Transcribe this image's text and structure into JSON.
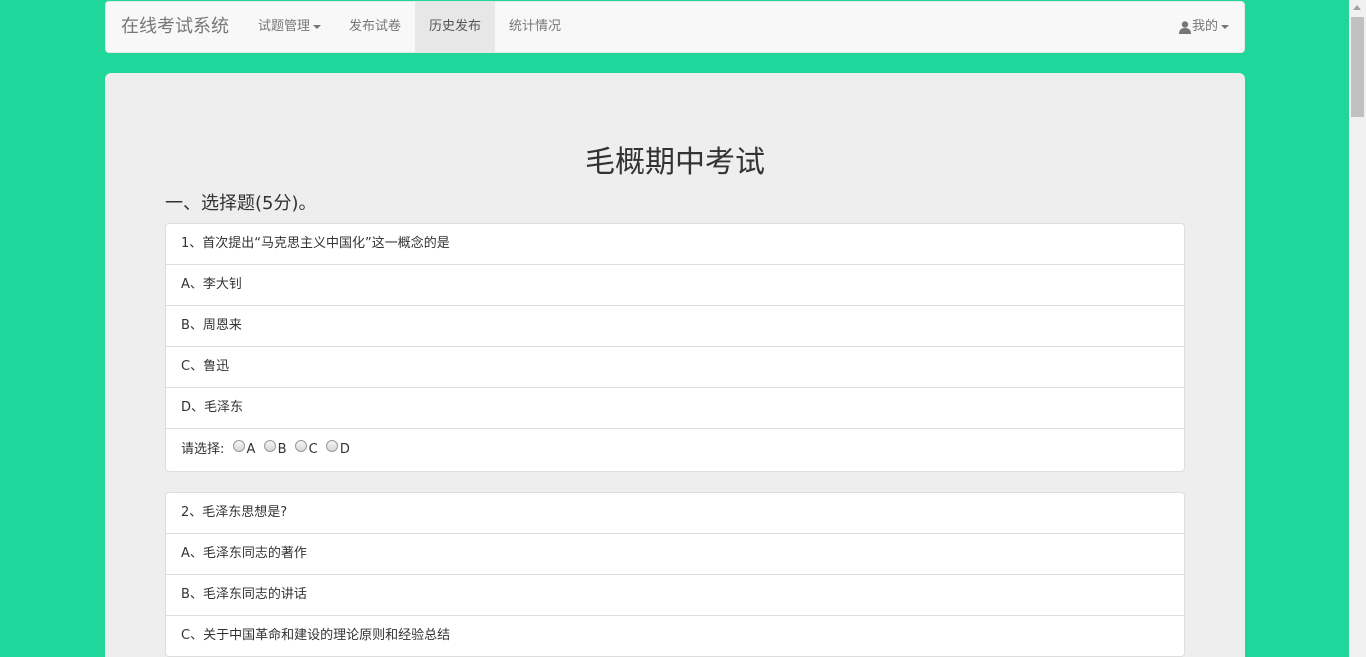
{
  "nav": {
    "brand": "在线考试系统",
    "items": [
      {
        "label": "试题管理",
        "dropdown": true
      },
      {
        "label": "发布试卷"
      },
      {
        "label": "历史发布",
        "active": true
      },
      {
        "label": "统计情况"
      }
    ],
    "user_menu": "我的"
  },
  "exam": {
    "title": "毛概期中考试",
    "section_title": "一、选择题(5分)。",
    "answer_prompt": "请选择:",
    "questions": [
      {
        "stem": "1、首次提出“马克思主义中国化”这一概念的是",
        "options": [
          "A、李大钊",
          "B、周恩来",
          "C、鲁迅",
          "D、毛泽东"
        ],
        "choices": [
          "A",
          "B",
          "C",
          "D"
        ]
      },
      {
        "stem": "2、毛泽东思想是?",
        "options": [
          "A、毛泽东同志的著作",
          "B、毛泽东同志的讲话",
          "C、关于中国革命和建设的理论原则和经验总结"
        ]
      }
    ]
  },
  "colors": {
    "background": "#1fd69b",
    "navbar": "#f8f8f8",
    "panel": "#eeeeee",
    "active_nav": "#e7e7e7"
  }
}
